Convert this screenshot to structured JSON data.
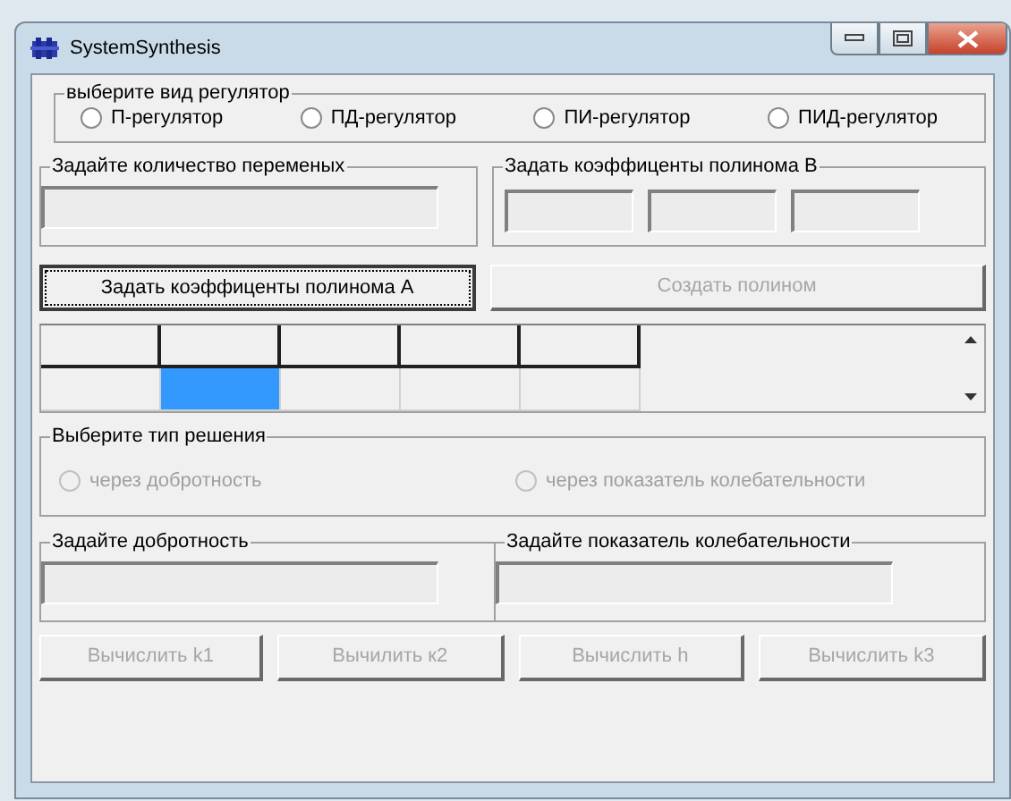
{
  "window": {
    "title": "SystemSynthesis"
  },
  "regulator_group": {
    "title": "выберите вид регулятор",
    "options": [
      {
        "label": "П-регулятор",
        "checked": false,
        "disabled": false
      },
      {
        "label": "ПД-регулятор",
        "checked": false,
        "disabled": false
      },
      {
        "label": "ПИ-регулятор",
        "checked": false,
        "disabled": false
      },
      {
        "label": "ПИД-регулятор",
        "checked": false,
        "disabled": false
      }
    ]
  },
  "variables_group": {
    "title": "Задайте количество переменых",
    "fields": [
      {
        "kind": "text"
      }
    ]
  },
  "poly_b_group": {
    "title": "Задать коэффиценты полинома В",
    "fields": [
      {
        "kind": "text"
      },
      {
        "kind": "text"
      },
      {
        "kind": "text"
      }
    ]
  },
  "buttons_top": [
    {
      "label": "Задать коэффиценты полинома А",
      "disabled": false,
      "focused": true
    },
    {
      "label": "Создать полином",
      "disabled": true,
      "focused": false
    }
  ],
  "grid": {
    "rows": [
      {
        "kind": "fixed",
        "cells": [
          {
            "selected": false
          },
          {
            "selected": false
          },
          {
            "selected": false
          },
          {
            "selected": false
          },
          {
            "selected": false
          }
        ]
      },
      {
        "kind": "normal",
        "cells": [
          {
            "selected": false
          },
          {
            "selected": true
          },
          {
            "selected": false
          },
          {
            "selected": false
          },
          {
            "selected": false
          }
        ]
      }
    ]
  },
  "solution_group": {
    "title": "Выберите тип решения",
    "options": [
      {
        "label": "через добротность",
        "checked": false,
        "disabled": true
      },
      {
        "label": "через показатель колебательности",
        "checked": false,
        "disabled": true
      }
    ]
  },
  "quality_group": {
    "title": "Задайте добротность",
    "fields": [
      {
        "kind": "text"
      }
    ]
  },
  "oscillation_group": {
    "title": "Задайте показатель колебательности",
    "fields": [
      {
        "kind": "text"
      }
    ]
  },
  "buttons_bottom": [
    {
      "label": "Вычислить k1",
      "disabled": true,
      "focused": false
    },
    {
      "label": "Вычилить к2",
      "disabled": true,
      "focused": false
    },
    {
      "label": "Вычислить h",
      "disabled": true,
      "focused": false
    },
    {
      "label": "Вычислить k3",
      "disabled": true,
      "focused": false
    }
  ]
}
